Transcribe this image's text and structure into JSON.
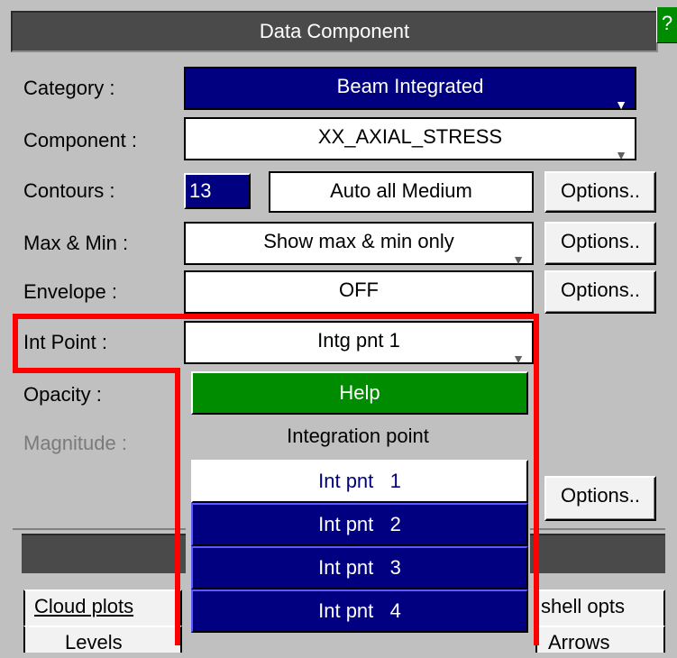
{
  "window": {
    "title": "Data Component",
    "help_label": "?"
  },
  "rows": {
    "category": {
      "label": "Category :",
      "value": "Beam Integrated"
    },
    "component": {
      "label": "Component :",
      "value": "XX_AXIAL_STRESS"
    },
    "contours": {
      "label": "Contours :",
      "count": "13",
      "mode": "Auto all Medium",
      "options": "Options.."
    },
    "maxmin": {
      "label": "Max & Min :",
      "value": "Show max & min only",
      "options": "Options.."
    },
    "envelope": {
      "label": "Envelope :",
      "value": "OFF",
      "options": "Options.."
    },
    "intpoint": {
      "label": "Int Point :",
      "value": "Intg pnt 1"
    },
    "opacity": {
      "label": "Opacity :"
    },
    "magnitude": {
      "label": "Magnitude :"
    },
    "extra": {
      "options": "Options.."
    }
  },
  "tabs": {
    "cloud": "Cloud plots",
    "levels": "Levels",
    "shell": "shell opts",
    "arrows": "Arrows"
  },
  "menu": {
    "help": "Help",
    "title": "Integration point",
    "items": [
      "Int pnt   1",
      "Int pnt   2",
      "Int pnt   3",
      "Int pnt   4"
    ],
    "selected_index": 0
  },
  "colors": {
    "panel": "#c0c0c0",
    "selected_blue": "#000080",
    "help_green": "#008c00",
    "highlight": "#ff0000"
  }
}
